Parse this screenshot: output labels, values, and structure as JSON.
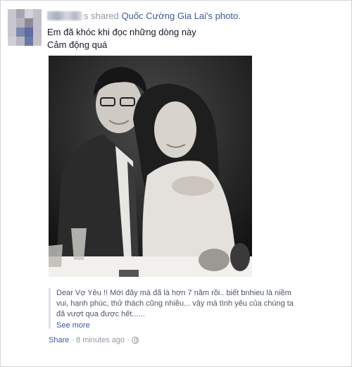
{
  "post": {
    "author_suffix": "s shared ",
    "shared_from": "Quốc Cường Gia Lai",
    "shared_object": "'s photo.",
    "message_line1": "Em đã khóc khi đọc những dòng này",
    "message_line2": "Cảm động quá",
    "quote": "Dear Vợ Yêu !! Mới đây mà đã là hơn 7 năm rồi.. biết bnhieu là niềm vui, hạnh phúc, thử thách cũng nhiều... vậy mà tình yêu của chúng ta đã vượt qua được hết......",
    "see_more": "See more",
    "share_label": "Share",
    "separator": "·",
    "time": "8 minutes ago",
    "privacy_icon": "globe-icon"
  },
  "colors": {
    "link": "#3b5998",
    "meta": "#9197a3",
    "text": "#141823"
  }
}
